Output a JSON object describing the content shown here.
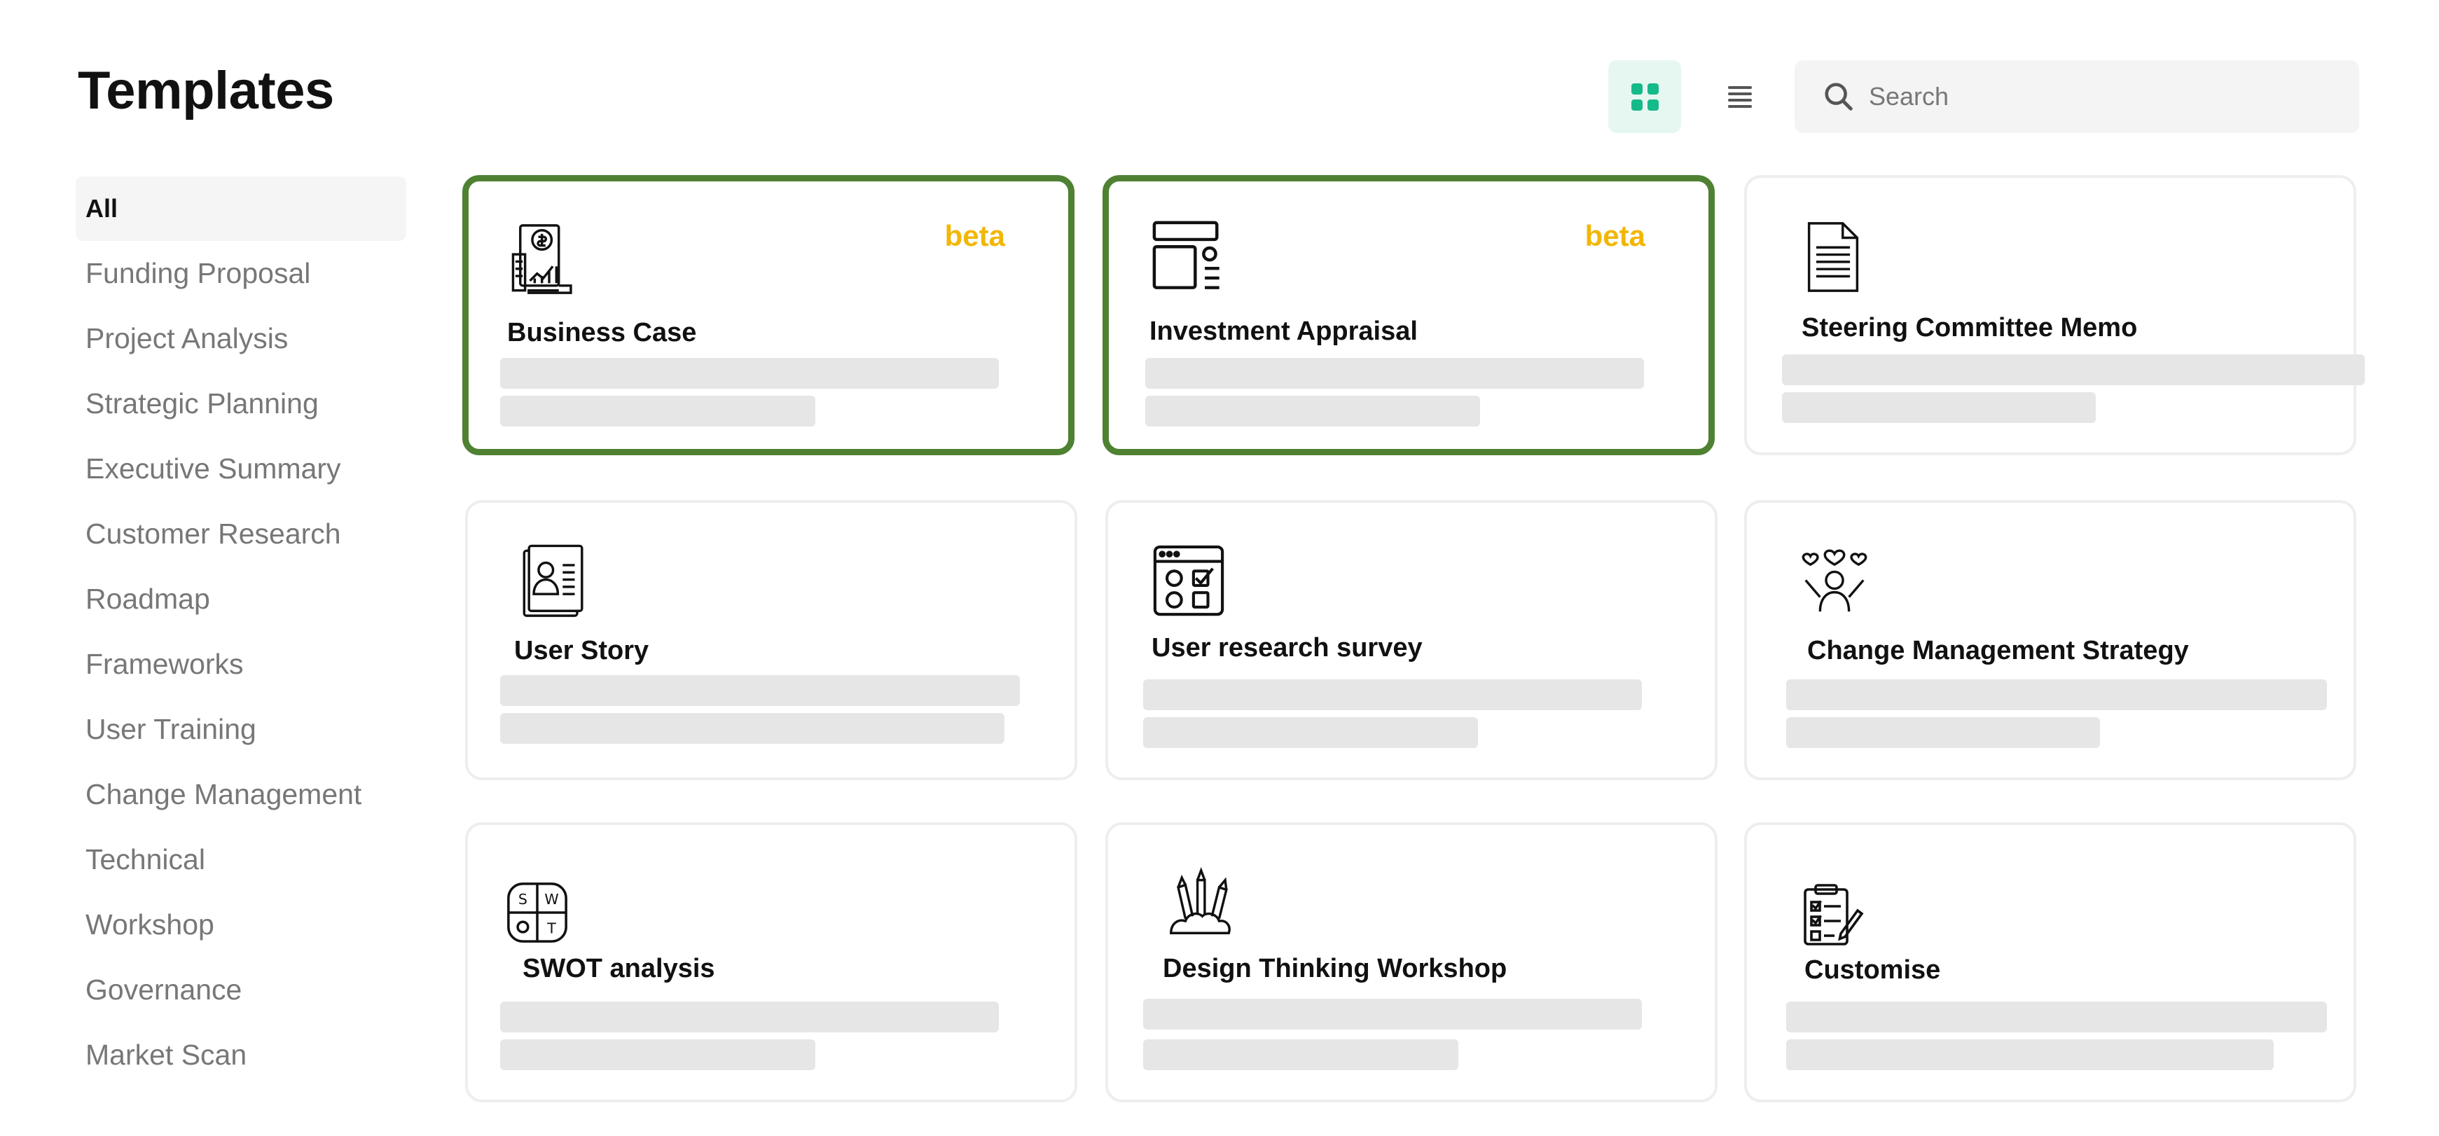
{
  "header": {
    "title": "Templates"
  },
  "toolbar": {
    "grid_view": "grid-icon",
    "list_view": "list-icon",
    "search_placeholder": "Search"
  },
  "sidebar": {
    "items": [
      {
        "label": "All",
        "active": true
      },
      {
        "label": "Funding Proposal"
      },
      {
        "label": "Project Analysis"
      },
      {
        "label": "Strategic Planning"
      },
      {
        "label": "Executive Summary"
      },
      {
        "label": "Customer Research"
      },
      {
        "label": "Roadmap"
      },
      {
        "label": "Frameworks"
      },
      {
        "label": "User Training"
      },
      {
        "label": "Change Management"
      },
      {
        "label": "Technical"
      },
      {
        "label": "Workshop"
      },
      {
        "label": "Governance"
      },
      {
        "label": "Market Scan"
      }
    ]
  },
  "cards": [
    {
      "title": "Business Case",
      "badge": "beta",
      "icon": "business-case-icon",
      "selected": true
    },
    {
      "title": "Investment Appraisal",
      "badge": "beta",
      "icon": "layout-icon",
      "selected": true
    },
    {
      "title": "Steering Committee Memo",
      "icon": "document-icon"
    },
    {
      "title": "User Story",
      "icon": "user-profile-icon"
    },
    {
      "title": "User research survey",
      "icon": "survey-icon"
    },
    {
      "title": "Change Management Strategy",
      "icon": "people-hearts-icon"
    },
    {
      "title": "SWOT analysis",
      "icon": "swot-icon"
    },
    {
      "title": "Design Thinking Workshop",
      "icon": "pencils-icon"
    },
    {
      "title": "Customise",
      "icon": "clipboard-icon"
    }
  ],
  "colors": {
    "accent": "#16b98a",
    "selected_border": "#4f8132",
    "badge": "#f2b705"
  }
}
